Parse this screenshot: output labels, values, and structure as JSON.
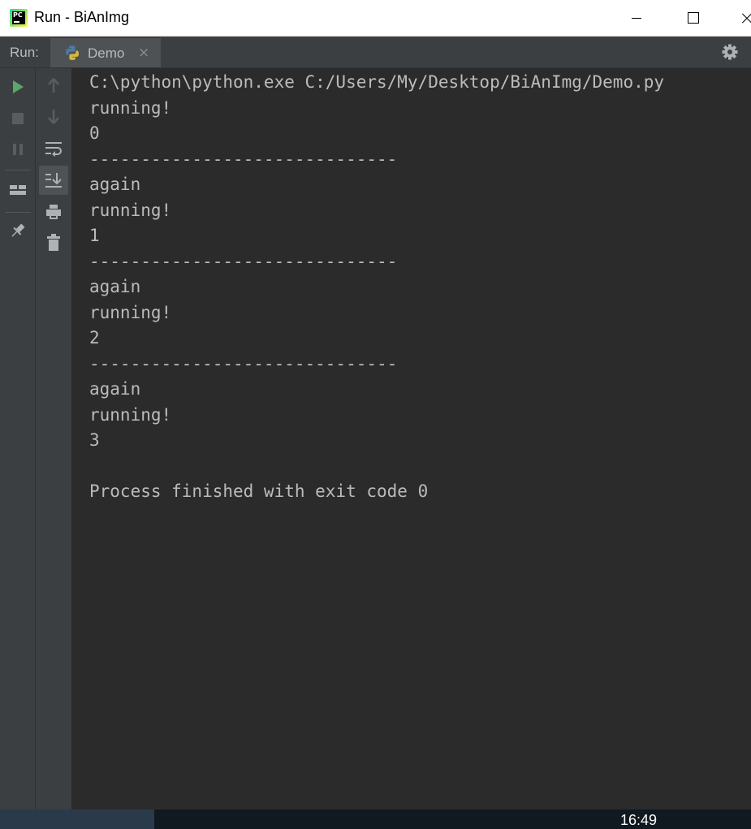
{
  "window": {
    "title": "Run - BiAnImg"
  },
  "run_panel": {
    "label": "Run:",
    "tab": {
      "label": "Demo",
      "close": "×"
    }
  },
  "console": {
    "lines": [
      "C:\\python\\python.exe C:/Users/My/Desktop/BiAnImg/Demo.py",
      "running!",
      "0",
      "------------------------------",
      "again",
      "running!",
      "1",
      "------------------------------",
      "again",
      "running!",
      "2",
      "------------------------------",
      "again",
      "running!",
      "3",
      "",
      "Process finished with exit code 0"
    ]
  },
  "taskbar": {
    "clock": "16:49"
  },
  "colors": {
    "console_bg": "#2b2b2b",
    "panel_bg": "#3c3f41",
    "text": "#bbbbbb",
    "run_green": "#59a869"
  },
  "icons": [
    "pycharm-app-icon",
    "python-icon",
    "gear-icon",
    "run-icon",
    "stop-icon",
    "pause-icon",
    "layout-icon",
    "pin-icon",
    "up-arrow-icon",
    "down-arrow-icon",
    "soft-wrap-icon",
    "scroll-to-end-icon",
    "print-icon",
    "trash-icon"
  ]
}
